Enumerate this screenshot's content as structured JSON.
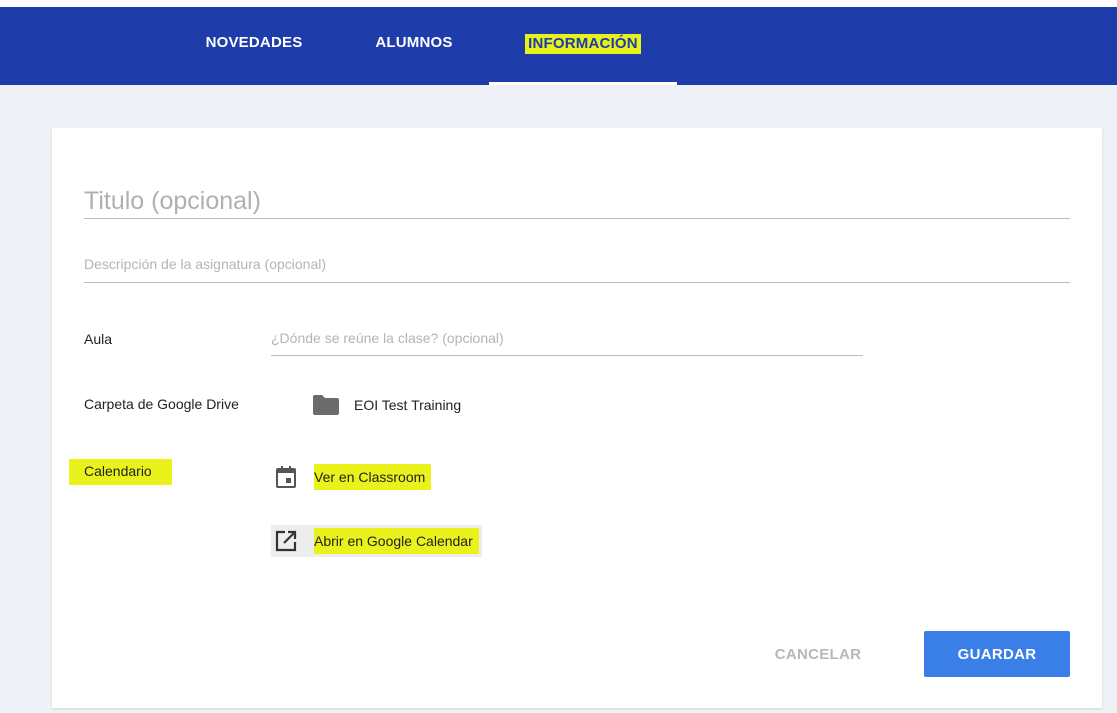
{
  "nav": {
    "tabs": [
      {
        "label": "NOVEDADES"
      },
      {
        "label": "ALUMNOS"
      },
      {
        "label": "INFORMACIÓN"
      }
    ],
    "active_tab": "INFORMACIÓN"
  },
  "form": {
    "title_placeholder": "Titulo (opcional)",
    "description_placeholder": "Descripción de la asignatura (opcional)",
    "room": {
      "label": "Aula",
      "placeholder": "¿Dónde se reúne la clase? (opcional)"
    },
    "drive": {
      "label": "Carpeta de Google Drive",
      "folder_name": "EOI Test Training",
      "icon": "folder-icon"
    },
    "calendar": {
      "label": "Calendario",
      "view_in_classroom": "Ver en Classroom",
      "view_icon": "calendar-icon",
      "open_in_gcal": "Abrir en Google Calendar",
      "open_icon": "open-in-new-icon"
    }
  },
  "actions": {
    "cancel_label": "CANCELAR",
    "save_label": "GUARDAR"
  },
  "colors": {
    "nav_bg": "#1e3caa",
    "highlight": "#eaf21c",
    "primary_button": "#3a7ee8",
    "page_bg": "#eef2f6"
  }
}
